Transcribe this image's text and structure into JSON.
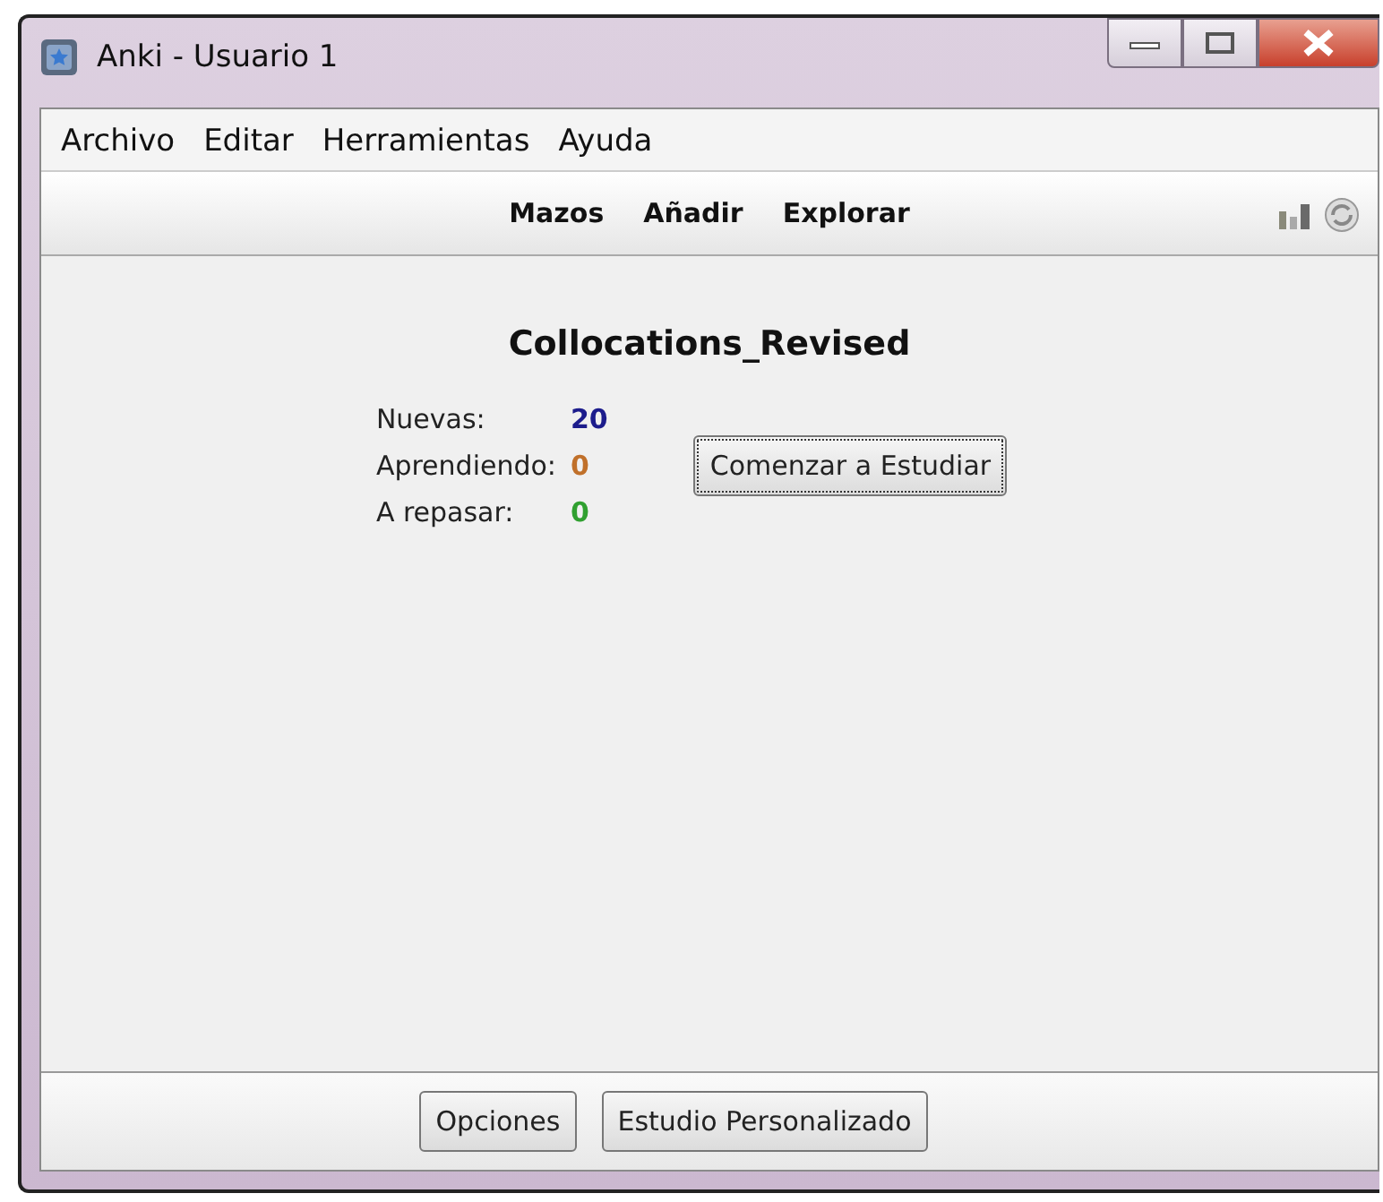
{
  "window": {
    "title": "Anki - Usuario 1"
  },
  "menu": [
    "Archivo",
    "Editar",
    "Herramientas",
    "Ayuda"
  ],
  "toolbar": [
    "Mazos",
    "Añadir",
    "Explorar"
  ],
  "deck": {
    "title": "Collocations_Revised",
    "counts": [
      {
        "label": "Nuevas:",
        "value": "20",
        "color": "#1c1c8c"
      },
      {
        "label": "Aprendiendo:",
        "value": "0",
        "color": "#c0702a"
      },
      {
        "label": "A repasar:",
        "value": "0",
        "color": "#30a030"
      }
    ],
    "study_button": "Comenzar a Estudiar"
  },
  "bottom_buttons": [
    "Opciones",
    "Estudio Personalizado"
  ]
}
